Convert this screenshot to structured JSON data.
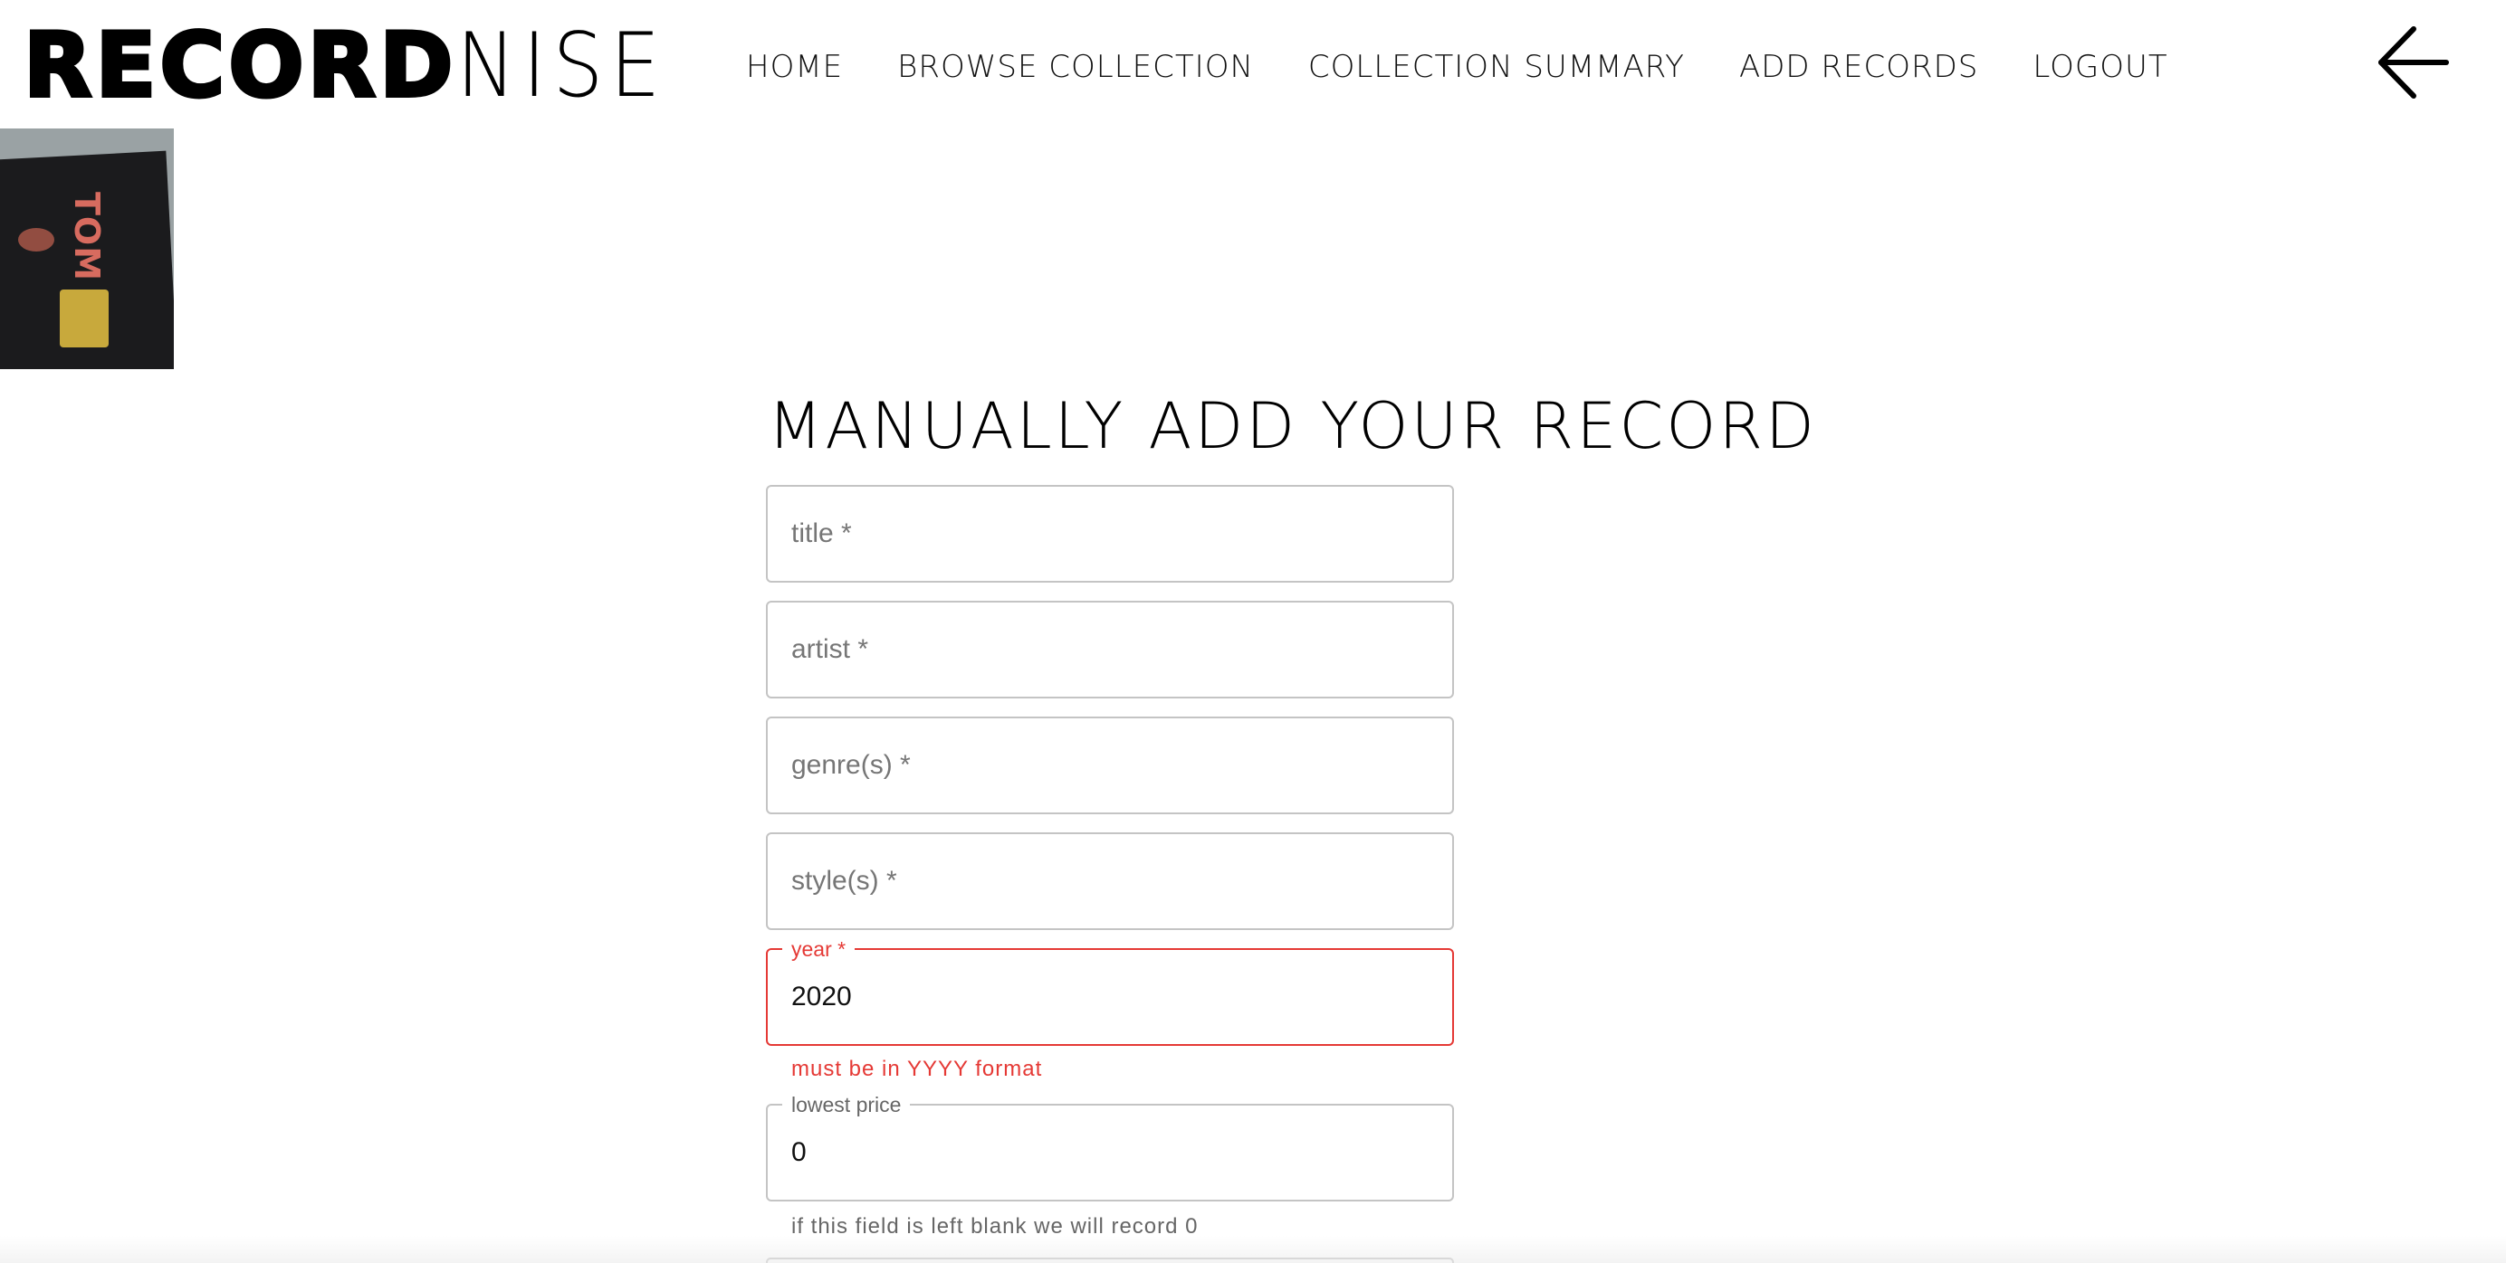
{
  "brand": {
    "bold": "RECORD",
    "thin": "NISE"
  },
  "nav": {
    "items": [
      {
        "label": "HOME"
      },
      {
        "label": "BROWSE COLLECTION"
      },
      {
        "label": "COLLECTION SUMMARY"
      },
      {
        "label": "ADD RECORDS"
      },
      {
        "label": "LOGOUT"
      }
    ],
    "back_icon": "arrow-left-icon"
  },
  "cover": {
    "text": "TOM ZÉ"
  },
  "form": {
    "title": "MANUALLY ADD YOUR RECORD",
    "fields": {
      "title": {
        "placeholder": "title *",
        "value": ""
      },
      "artist": {
        "placeholder": "artist *",
        "value": ""
      },
      "genres": {
        "placeholder": "genre(s) *",
        "value": ""
      },
      "styles": {
        "placeholder": "style(s) *",
        "value": ""
      },
      "year": {
        "label": "year *",
        "value": "2020",
        "error": "must be in YYYY format"
      },
      "lowest_price": {
        "label": "lowest price",
        "value": "0",
        "helper": "if this field is left blank we will record 0"
      }
    }
  },
  "colors": {
    "error": "#e53935",
    "border": "#c4c4c4",
    "placeholder": "#767676"
  }
}
